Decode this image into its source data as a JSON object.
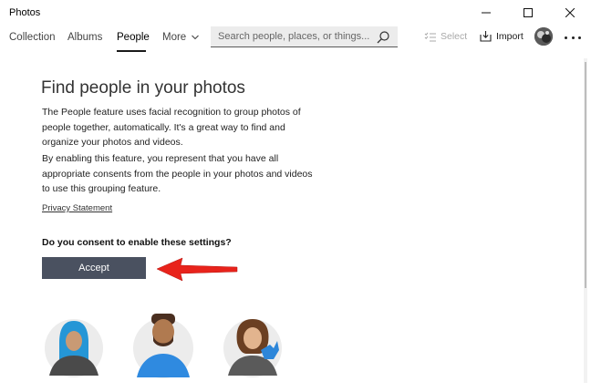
{
  "window": {
    "title": "Photos"
  },
  "nav": {
    "tabs": [
      {
        "label": "Collection"
      },
      {
        "label": "Albums"
      },
      {
        "label": "People"
      },
      {
        "label": "More"
      }
    ],
    "active_tab": "People",
    "search_placeholder": "Search people, places, or things...",
    "select_label": "Select",
    "import_label": "Import"
  },
  "main": {
    "heading": "Find people in your photos",
    "paragraph1": "The People feature uses facial recognition to group photos of people together, automatically. It's a great way to find and organize your photos and videos.",
    "paragraph2": "By enabling this feature, you represent that you have all appropriate consents from the people in your photos and videos to use this grouping feature.",
    "privacy_link": "Privacy Statement",
    "consent_question": "Do you consent to enable these settings?",
    "accept_label": "Accept"
  },
  "colors": {
    "accept_bg": "#4a5160",
    "annotation_arrow": "#e8231b"
  },
  "icons": [
    "minimize-icon",
    "maximize-icon",
    "close-icon",
    "chevron-down-icon",
    "search-icon",
    "select-icon",
    "import-icon",
    "more-options-icon"
  ]
}
